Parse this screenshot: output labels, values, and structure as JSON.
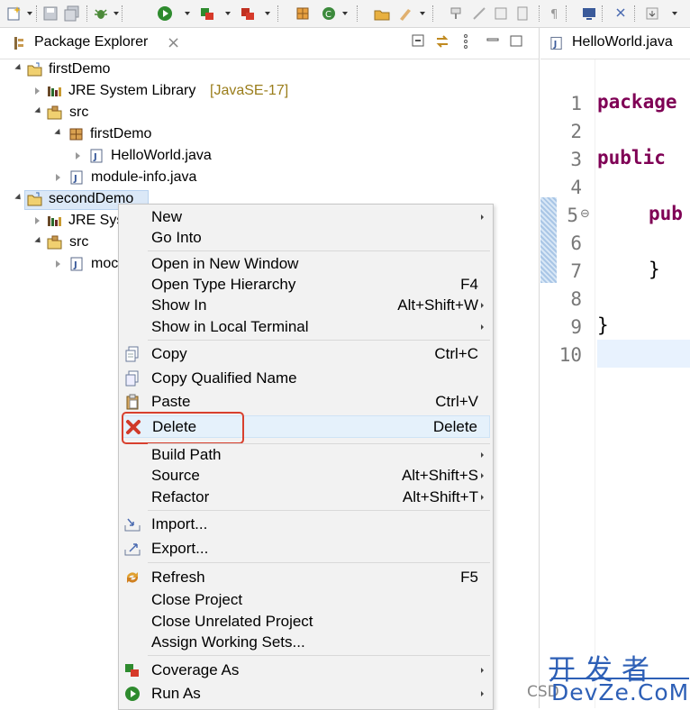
{
  "toolbar": {
    "icons": [
      "new-wizard-icon",
      "save-icon",
      "save-all-icon",
      "debug-icon",
      "run-icon",
      "coverage-icon",
      "external-tools-icon",
      "new-java-project-icon",
      "new-class-icon",
      "open-type-icon",
      "search-icon",
      "toggle-markers-icon",
      "show-whitespace-icon",
      "toggle-breadcrumb-icon",
      "mark-occurrences-icon",
      "next-annotation-icon"
    ]
  },
  "explorer": {
    "title": "Package Explorer",
    "items": [
      {
        "label": "firstDemo",
        "decoration": ""
      },
      {
        "label": "JRE System Library",
        "decoration": "[JavaSE-17]"
      },
      {
        "label": "src",
        "decoration": ""
      },
      {
        "label": "firstDemo",
        "decoration": ""
      },
      {
        "label": "HelloWorld.java",
        "decoration": ""
      },
      {
        "label": "module-info.java",
        "decoration": ""
      },
      {
        "label": "secondDemo",
        "decoration": ""
      },
      {
        "label": "JRE Sys",
        "decoration": ""
      },
      {
        "label": "src",
        "decoration": ""
      },
      {
        "label": "moc",
        "decoration": ""
      }
    ]
  },
  "editor": {
    "tab_label": "HelloWorld.java",
    "line_numbers": [
      "1",
      "2",
      "3",
      "4",
      "5",
      "6",
      "7",
      "8",
      "9",
      "10"
    ],
    "code": {
      "l1": "package",
      "l3": "public",
      "l5": "pub",
      "l7": "}",
      "l9": "}"
    },
    "fold_marker": "⊖"
  },
  "context_menu": {
    "items": [
      {
        "label": "New",
        "shortcut": "",
        "submenu": true
      },
      {
        "label": "Go Into",
        "shortcut": "",
        "submenu": false
      },
      {
        "label": "Open in New Window",
        "shortcut": "",
        "submenu": false
      },
      {
        "label": "Open Type Hierarchy",
        "shortcut": "F4",
        "submenu": false
      },
      {
        "label": "Show In",
        "shortcut": "Alt+Shift+W",
        "submenu": true
      },
      {
        "label": "Show in Local Terminal",
        "shortcut": "",
        "submenu": true
      },
      {
        "label": "Copy",
        "shortcut": "Ctrl+C",
        "submenu": false
      },
      {
        "label": "Copy Qualified Name",
        "shortcut": "",
        "submenu": false
      },
      {
        "label": "Paste",
        "shortcut": "Ctrl+V",
        "submenu": false
      },
      {
        "label": "Delete",
        "shortcut": "Delete",
        "submenu": false
      },
      {
        "label": "Build Path",
        "shortcut": "",
        "submenu": true
      },
      {
        "label": "Source",
        "shortcut": "Alt+Shift+S",
        "submenu": true
      },
      {
        "label": "Refactor",
        "shortcut": "Alt+Shift+T",
        "submenu": true
      },
      {
        "label": "Import...",
        "shortcut": "",
        "submenu": false
      },
      {
        "label": "Export...",
        "shortcut": "",
        "submenu": false
      },
      {
        "label": "Refresh",
        "shortcut": "F5",
        "submenu": false
      },
      {
        "label": "Close Project",
        "shortcut": "",
        "submenu": false
      },
      {
        "label": "Close Unrelated Project",
        "shortcut": "",
        "submenu": false
      },
      {
        "label": "Assign Working Sets...",
        "shortcut": "",
        "submenu": false
      },
      {
        "label": "Coverage As",
        "shortcut": "",
        "submenu": true
      },
      {
        "label": "Run As",
        "shortcut": "",
        "submenu": true
      }
    ]
  },
  "watermark": {
    "line1": "开发者",
    "line2": "DevZe.CoM",
    "prefix": "CSD"
  },
  "colors": {
    "keyword": "#7f0055",
    "highlight_border": "#d8402e",
    "watermark": "#2d5fb6"
  }
}
